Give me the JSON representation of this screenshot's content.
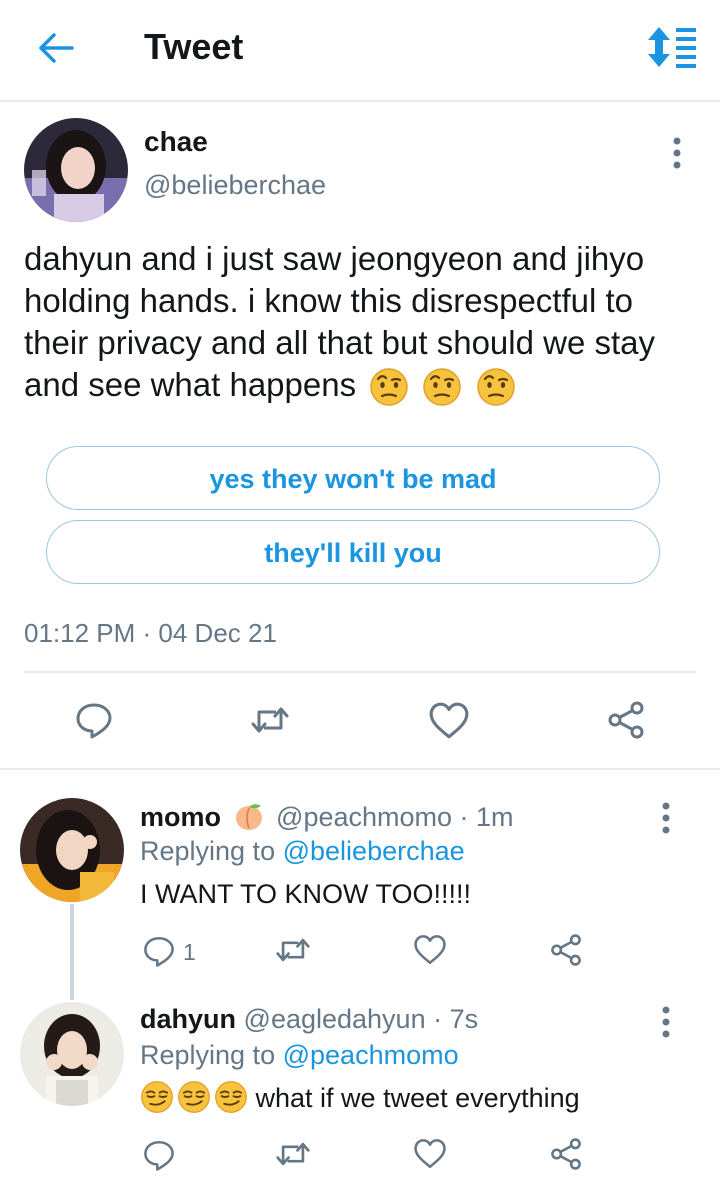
{
  "header": {
    "title": "Tweet"
  },
  "tweet": {
    "name": "chae",
    "handle": "@belieberchae",
    "text": "dahyun and i just saw jeongyeon and jihyo holding hands. i know this disrespectful to their privacy and all that but should we stay and see what happens",
    "poll": [
      "yes they won't be mad",
      "they'll kill you"
    ],
    "timestamp": "01:12 PM · 04 Dec 21"
  },
  "replies": [
    {
      "name": "momo",
      "handle": "@peachmomo · 1m",
      "replying_prefix": "Replying to",
      "replying_to": "@belieberchae",
      "text": "I WANT TO KNOW TOO!!!!!",
      "reply_count": "1"
    },
    {
      "name": "dahyun",
      "handle": "@eagledahyun · 7s",
      "replying_prefix": "Replying to",
      "replying_to": "@peachmomo",
      "text": "what if we tweet everything"
    }
  ],
  "colors": {
    "accent": "#1b95e0",
    "muted": "#657786",
    "border": "#e6ecf0"
  }
}
